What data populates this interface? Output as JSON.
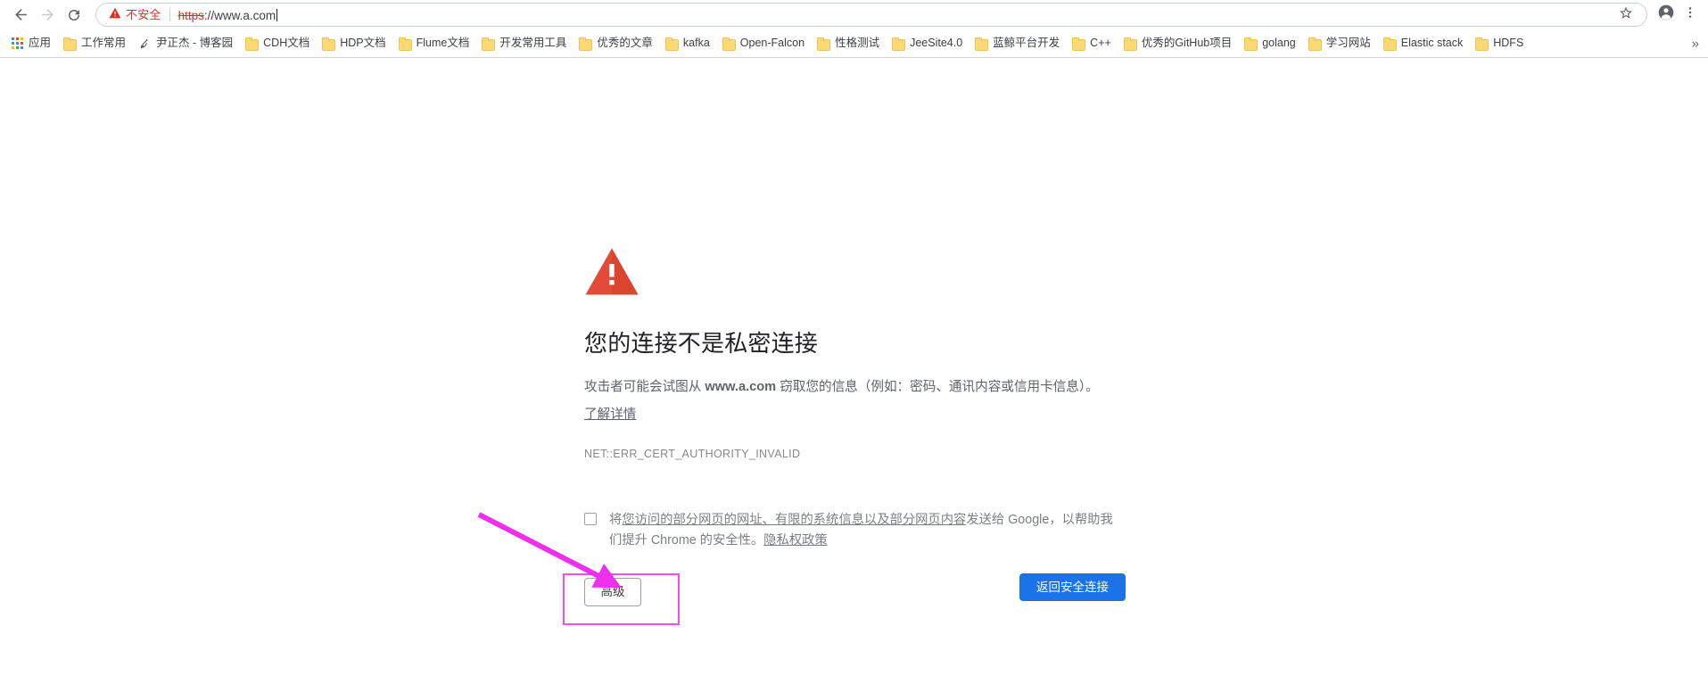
{
  "browser": {
    "nav": {
      "back_icon": "arrow-left-icon",
      "forward_icon": "arrow-right-icon",
      "reload_icon": "reload-icon"
    },
    "omnibox": {
      "security_icon": "warning-triangle-icon",
      "security_label": "不安全",
      "url_scheme": "https",
      "url_rest": "://www.a.com",
      "full_url": "https://www.a.com",
      "star_icon": "star-icon",
      "focused": true
    },
    "profile_icon": "account-avatar-icon",
    "menu_icon": "three-dot-menu-icon",
    "bookmarks": {
      "apps_label": "应用",
      "apps_icon": "apps-grid-icon",
      "overflow_label": "»",
      "items": [
        {
          "label": "工作常用",
          "icon": "folder-icon"
        },
        {
          "label": "尹正杰 - 博客园",
          "icon": "site-favicon"
        },
        {
          "label": "CDH文档",
          "icon": "folder-icon"
        },
        {
          "label": "HDP文档",
          "icon": "folder-icon"
        },
        {
          "label": "Flume文档",
          "icon": "folder-icon"
        },
        {
          "label": "开发常用工具",
          "icon": "folder-icon"
        },
        {
          "label": "优秀的文章",
          "icon": "folder-icon"
        },
        {
          "label": "kafka",
          "icon": "folder-icon"
        },
        {
          "label": "Open-Falcon",
          "icon": "folder-icon"
        },
        {
          "label": "性格测试",
          "icon": "folder-icon"
        },
        {
          "label": "JeeSite4.0",
          "icon": "folder-icon"
        },
        {
          "label": "蓝鲸平台开发",
          "icon": "folder-icon"
        },
        {
          "label": "C++",
          "icon": "folder-icon"
        },
        {
          "label": "优秀的GitHub项目",
          "icon": "folder-icon"
        },
        {
          "label": "golang",
          "icon": "folder-icon"
        },
        {
          "label": "学习网站",
          "icon": "folder-icon"
        },
        {
          "label": "Elastic stack",
          "icon": "folder-icon"
        },
        {
          "label": "HDFS",
          "icon": "folder-icon"
        }
      ]
    }
  },
  "interstitial": {
    "icon": "red-warning-triangle-icon",
    "heading": "您的连接不是私密连接",
    "paragraph_before": "攻击者可能会试图从 ",
    "host": "www.a.com",
    "paragraph_after": " 窃取您的信息（例如：密码、通讯内容或信用卡信息）。",
    "learn_more": "了解详情",
    "error_code": "NET::ERR_CERT_AUTHORITY_INVALID",
    "report": {
      "checked": false,
      "link_part": "您访问的部分网页的网址、有限的系统信息以及部分网页内容",
      "text_before": "将",
      "text_after": "发送给 Google，以帮助我们提升 Chrome 的安全性。",
      "privacy_link": "隐私权政策"
    },
    "advanced_button": "高级",
    "primary_button": "返回安全连接"
  },
  "annotations": {
    "highlight_color": "#ee4fee",
    "arrow_color": "#ee2fee"
  }
}
